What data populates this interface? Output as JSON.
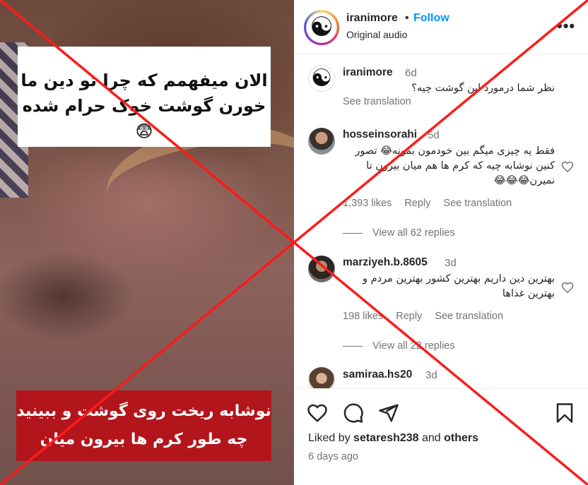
{
  "video": {
    "caption_top": "الان میفهمم که چرا تو دین ما خورن گوشت خوک حرام شده😨",
    "caption_bottom": "نوشابه ریخت روی گوشت و ببینید چه طور کرم ها  بیرون  میان"
  },
  "header": {
    "username": "iranimore",
    "dot": "•",
    "follow_label": "Follow",
    "audio_label": "Original audio",
    "more_icon": "more-options-icon"
  },
  "comments": [
    {
      "username": "iranimore",
      "time": "6d",
      "text": "نظر شما درمورد این گوشت چیه؟",
      "see_translation": "See translation"
    },
    {
      "username": "hosseinsorahi",
      "time": "5d",
      "text": "فقط یه چیزی میگم بین خودمون بمونه😂 تصور کنین نوشابه چیه که کرم ها هم میان بیرون تا نمیرن😂😂😂",
      "likes": "1,393 likes",
      "reply": "Reply",
      "see_translation": "See translation",
      "view_replies": "View all 62 replies"
    },
    {
      "username": "marziyeh.b.8605",
      "time": "3d",
      "text": "بهترین دین داریم بهترین کشور بهترین مردم و بهترین غذاها",
      "likes": "198 likes",
      "reply": "Reply",
      "see_translation": "See translation",
      "view_replies": "View all 22 replies"
    },
    {
      "username": "samiraa.hs20",
      "time": "3d"
    }
  ],
  "actions": {
    "liked_by_prefix": "Liked by ",
    "liked_by_user": "setaresh238",
    "liked_by_and": " and ",
    "liked_by_others": "others",
    "date": "6 days ago"
  },
  "overlay": {
    "color": "#ff1a1a"
  }
}
